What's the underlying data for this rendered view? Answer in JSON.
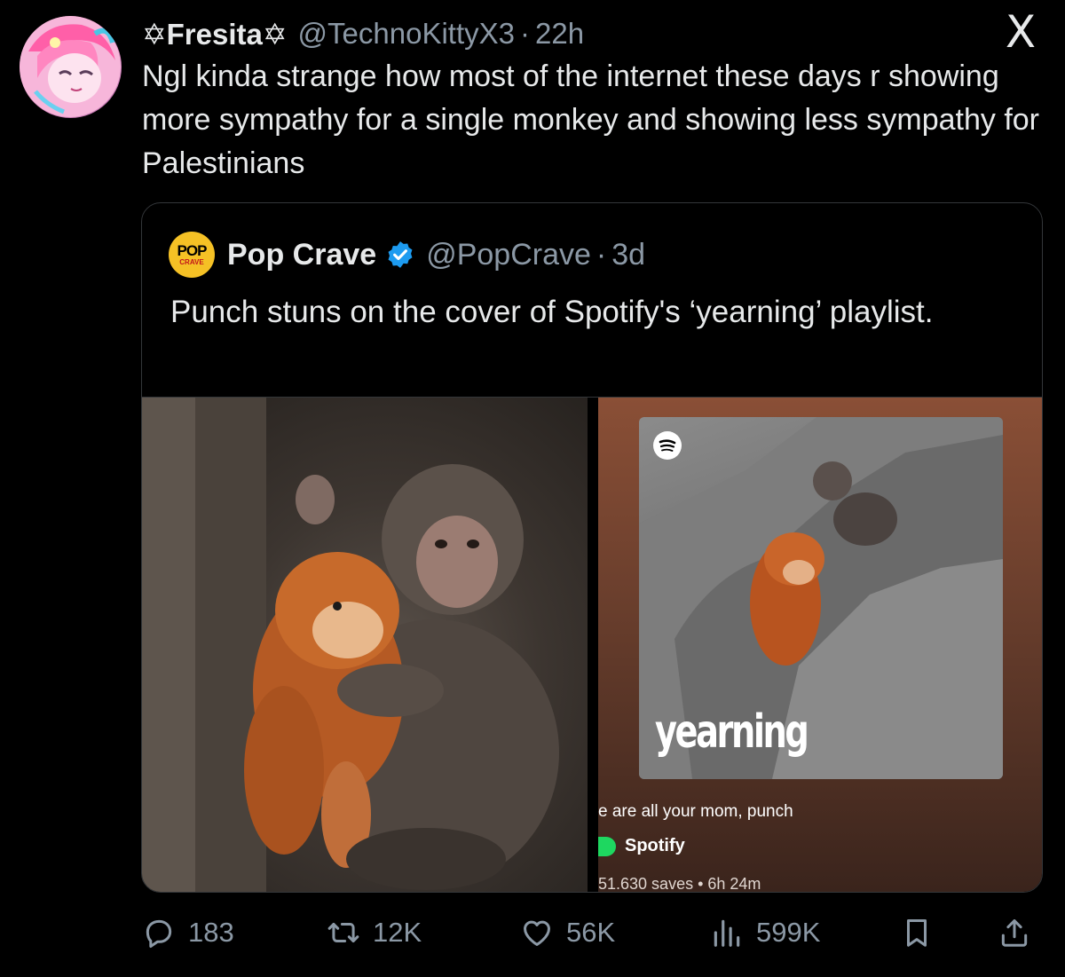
{
  "tweet": {
    "display_name": "✡Fresita✡",
    "handle": "@TechnoKittyX3",
    "separator": "·",
    "time": "22h",
    "text": "Ngl kinda strange how most of the internet these days r showing more sympathy for a single monkey and showing less sympathy for Palestinians",
    "brand_logo": "X",
    "avatar_icon": "anime-girl-avatar"
  },
  "quote": {
    "logo_line1": "POP",
    "logo_line2": "CRAVE",
    "display_name": "Pop Crave",
    "verified_icon": "verified-badge-icon",
    "handle": "@PopCrave",
    "separator": "·",
    "time": "3d",
    "text": "Punch stuns on the cover of Spotify's ‘yearning’ playlist.",
    "media": {
      "left_image": "baby monkey hugging orange plush toy",
      "right_image": "spotify playlist screenshot",
      "cover_title": "yearning",
      "playlist_description": "e are all your mom, punch",
      "playlist_owner": "Spotify",
      "playlist_meta": "51.630 saves • 6h 24m"
    }
  },
  "actions": {
    "replies": "183",
    "reposts": "12K",
    "likes": "56K",
    "views": "599K",
    "icons": [
      "reply-icon",
      "repost-icon",
      "like-icon",
      "views-icon",
      "bookmark-icon",
      "share-icon"
    ]
  },
  "colors": {
    "background": "#000000",
    "text_primary": "#e7e9ea",
    "text_secondary": "#8b98a5",
    "border": "#333639",
    "verified": "#1d9bf0",
    "spotify_green": "#1ed760"
  }
}
